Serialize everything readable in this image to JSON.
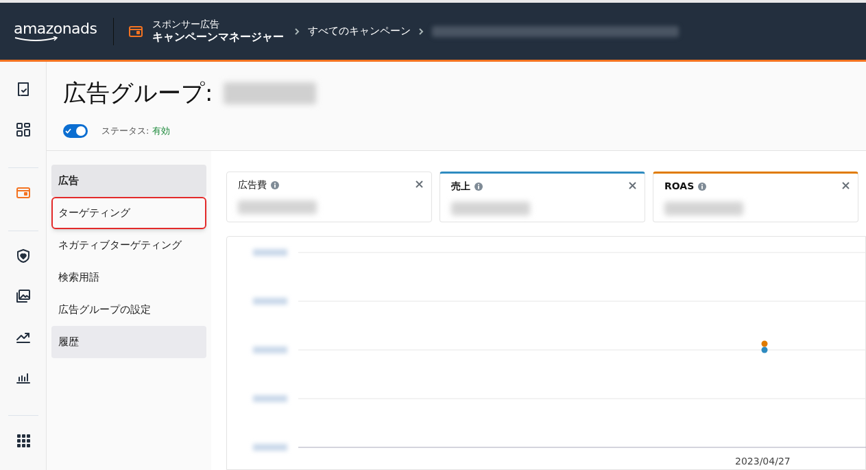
{
  "header": {
    "logo": "amazonads",
    "product_line1": "スポンサー広告",
    "product_line2": "キャンペーンマネージャー",
    "breadcrumbs": [
      "すべてのキャンペーン"
    ]
  },
  "rail": [
    {
      "kind": "checklist",
      "selected": false
    },
    {
      "kind": "grid",
      "selected": false
    },
    {
      "kind": "campaign",
      "selected": true
    },
    {
      "kind": "shield",
      "selected": false
    },
    {
      "kind": "images",
      "selected": false
    },
    {
      "kind": "trend",
      "selected": false
    },
    {
      "kind": "bars",
      "selected": false
    },
    {
      "kind": "apps",
      "selected": false
    }
  ],
  "page": {
    "title": "広告グループ:",
    "status_on": true,
    "status_label": "ステータス:",
    "status_value": "有効"
  },
  "subnav": [
    {
      "label": "広告",
      "selected": true,
      "hovered": false,
      "annotated": false
    },
    {
      "label": "ターゲティング",
      "selected": false,
      "hovered": false,
      "annotated": true
    },
    {
      "label": "ネガティブターゲティング",
      "selected": false,
      "hovered": false,
      "annotated": false
    },
    {
      "label": "検索用語",
      "selected": false,
      "hovered": false,
      "annotated": false
    },
    {
      "label": "広告グループの設定",
      "selected": false,
      "hovered": false,
      "annotated": false
    },
    {
      "label": "履歴",
      "selected": false,
      "hovered": true,
      "annotated": false
    }
  ],
  "metrics": [
    {
      "label": "広告費",
      "selected": false
    },
    {
      "label": "売上",
      "selected": true,
      "color": "#2e8bc0"
    },
    {
      "label": "ROAS",
      "selected": true,
      "color": "#e07b00"
    }
  ],
  "chart": {
    "x_label": "2023/04/27"
  }
}
